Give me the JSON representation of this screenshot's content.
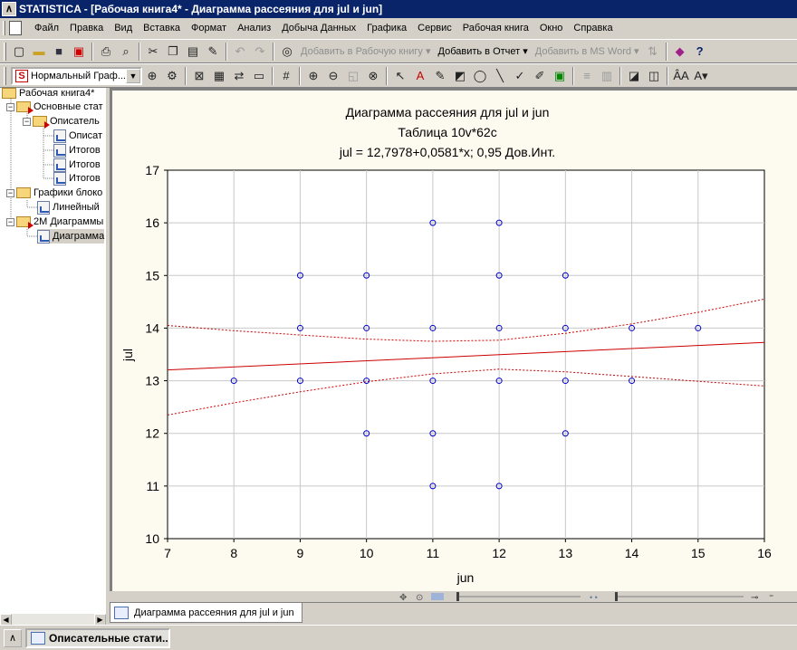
{
  "window": {
    "title": "STATISTICA - [Рабочая книга4* - Диаграмма рассеяния для jul и jun]",
    "app_icon": "statistica-icon"
  },
  "menu": [
    "Файл",
    "Правка",
    "Вид",
    "Вставка",
    "Формат",
    "Анализ",
    "Добыча Данных",
    "Графика",
    "Сервис",
    "Рабочая книга",
    "Окно",
    "Справка"
  ],
  "toolbar1": {
    "icons": [
      "new-icon",
      "open-icon",
      "save-icon",
      "pdf-icon",
      "print-icon",
      "print-preview-icon",
      "cut-icon",
      "copy-icon",
      "paste-icon",
      "format-painter-icon",
      "undo-icon",
      "redo-icon",
      "binoculars-icon"
    ],
    "add_workbook": "Добавить в Рабочую книгу",
    "add_report": "Добавить в Отчет",
    "add_word": "Добавить в MS Word",
    "help_icon": "help-pointer-icon"
  },
  "toolbar2": {
    "graph_combo": "Нормальный Граф..."
  },
  "tree": {
    "items": [
      {
        "label": "Рабочая книга4*",
        "level": 0,
        "type": "folder"
      },
      {
        "label": "Основные стат",
        "level": 1,
        "type": "folder-red",
        "expanded": true
      },
      {
        "label": "Описатель",
        "level": 2,
        "type": "folder-red",
        "expanded": true
      },
      {
        "label": "Описат",
        "level": 3,
        "type": "doc"
      },
      {
        "label": "Итогов",
        "level": 3,
        "type": "doc"
      },
      {
        "label": "Итогов",
        "level": 3,
        "type": "doc"
      },
      {
        "label": "Итогов",
        "level": 3,
        "type": "doc"
      },
      {
        "label": "Графики блоко",
        "level": 1,
        "type": "folder",
        "expanded": true
      },
      {
        "label": "Линейный",
        "level": 2,
        "type": "doc"
      },
      {
        "label": "2М Диаграммы",
        "level": 1,
        "type": "folder-red",
        "expanded": true
      },
      {
        "label": "Диаграмма",
        "level": 2,
        "type": "doc",
        "selected": true
      }
    ]
  },
  "tab": {
    "label": "Диаграмма рассеяния для jul и jun"
  },
  "taskbar": {
    "button": "Описательные стати..."
  },
  "chart_data": {
    "type": "scatter",
    "title": "Диаграмма рассеяния для jul и jun",
    "subtitle": "Таблица 10v*62c",
    "equation": "jul = 12,7978+0,0581*x; 0,95 Дов.Инт.",
    "xlabel": "jun",
    "ylabel": "jul",
    "xlim": [
      7,
      16
    ],
    "ylim": [
      10,
      17
    ],
    "xticks": [
      "7",
      "8",
      "9",
      "10",
      "11",
      "12",
      "13",
      "14",
      "15",
      "16"
    ],
    "yticks": [
      "10",
      "11",
      "12",
      "13",
      "14",
      "15",
      "16",
      "17"
    ],
    "grid": true,
    "points": [
      [
        8,
        13
      ],
      [
        9,
        15
      ],
      [
        9,
        14
      ],
      [
        9,
        13
      ],
      [
        10,
        15
      ],
      [
        10,
        14
      ],
      [
        10,
        13
      ],
      [
        10,
        12
      ],
      [
        11,
        16
      ],
      [
        11,
        14
      ],
      [
        11,
        13
      ],
      [
        11,
        12
      ],
      [
        11,
        11
      ],
      [
        12,
        16
      ],
      [
        12,
        15
      ],
      [
        12,
        14
      ],
      [
        12,
        13
      ],
      [
        12,
        11
      ],
      [
        13,
        15
      ],
      [
        13,
        14
      ],
      [
        13,
        13
      ],
      [
        13,
        12
      ],
      [
        14,
        14
      ],
      [
        14,
        13
      ],
      [
        15,
        14
      ]
    ],
    "regression": {
      "intercept": 12.7978,
      "slope": 0.0581
    },
    "ci_upper": [
      [
        7,
        14.05
      ],
      [
        8,
        13.95
      ],
      [
        9,
        13.87
      ],
      [
        10,
        13.79
      ],
      [
        11,
        13.75
      ],
      [
        12,
        13.77
      ],
      [
        13,
        13.9
      ],
      [
        14,
        14.08
      ],
      [
        15,
        14.3
      ],
      [
        16,
        14.55
      ]
    ],
    "ci_lower": [
      [
        7,
        12.35
      ],
      [
        8,
        12.58
      ],
      [
        9,
        12.79
      ],
      [
        10,
        12.98
      ],
      [
        11,
        13.13
      ],
      [
        12,
        13.22
      ],
      [
        13,
        13.17
      ],
      [
        14,
        13.08
      ],
      [
        15,
        12.99
      ],
      [
        16,
        12.9
      ]
    ],
    "colors": {
      "points": "#0000cc",
      "fit": "#cc0000",
      "grid": "#c8c8c8",
      "background": "#fdfaf0",
      "plot_background": "#ffffff"
    }
  }
}
